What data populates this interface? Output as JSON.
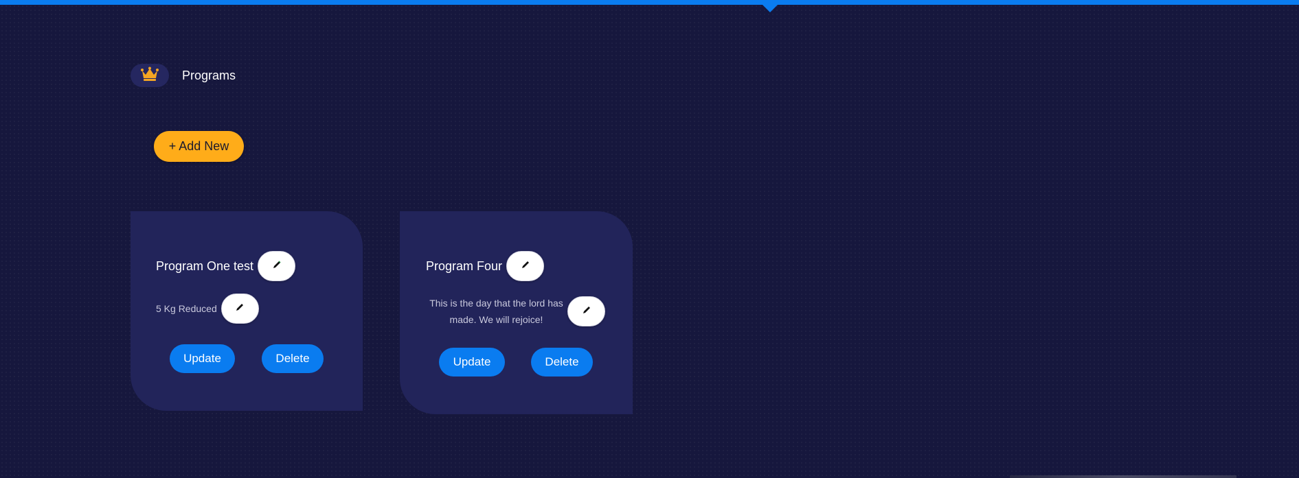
{
  "header": {
    "title": "Programs",
    "icon": "crown-icon",
    "icon_color": "#f5a623"
  },
  "toolbar": {
    "add_new_label": "+ Add New"
  },
  "programs": [
    {
      "title": "Program One test",
      "description": "5 Kg Reduced",
      "update_label": "Update",
      "delete_label": "Delete"
    },
    {
      "title": "Program Four",
      "description": "This is the day that the lord has made. We will rejoice!",
      "update_label": "Update",
      "delete_label": "Delete"
    }
  ],
  "colors": {
    "background": "#16173d",
    "card": "#22245a",
    "accent_blue": "#0a7cf0",
    "accent_orange": "#ffac19"
  }
}
